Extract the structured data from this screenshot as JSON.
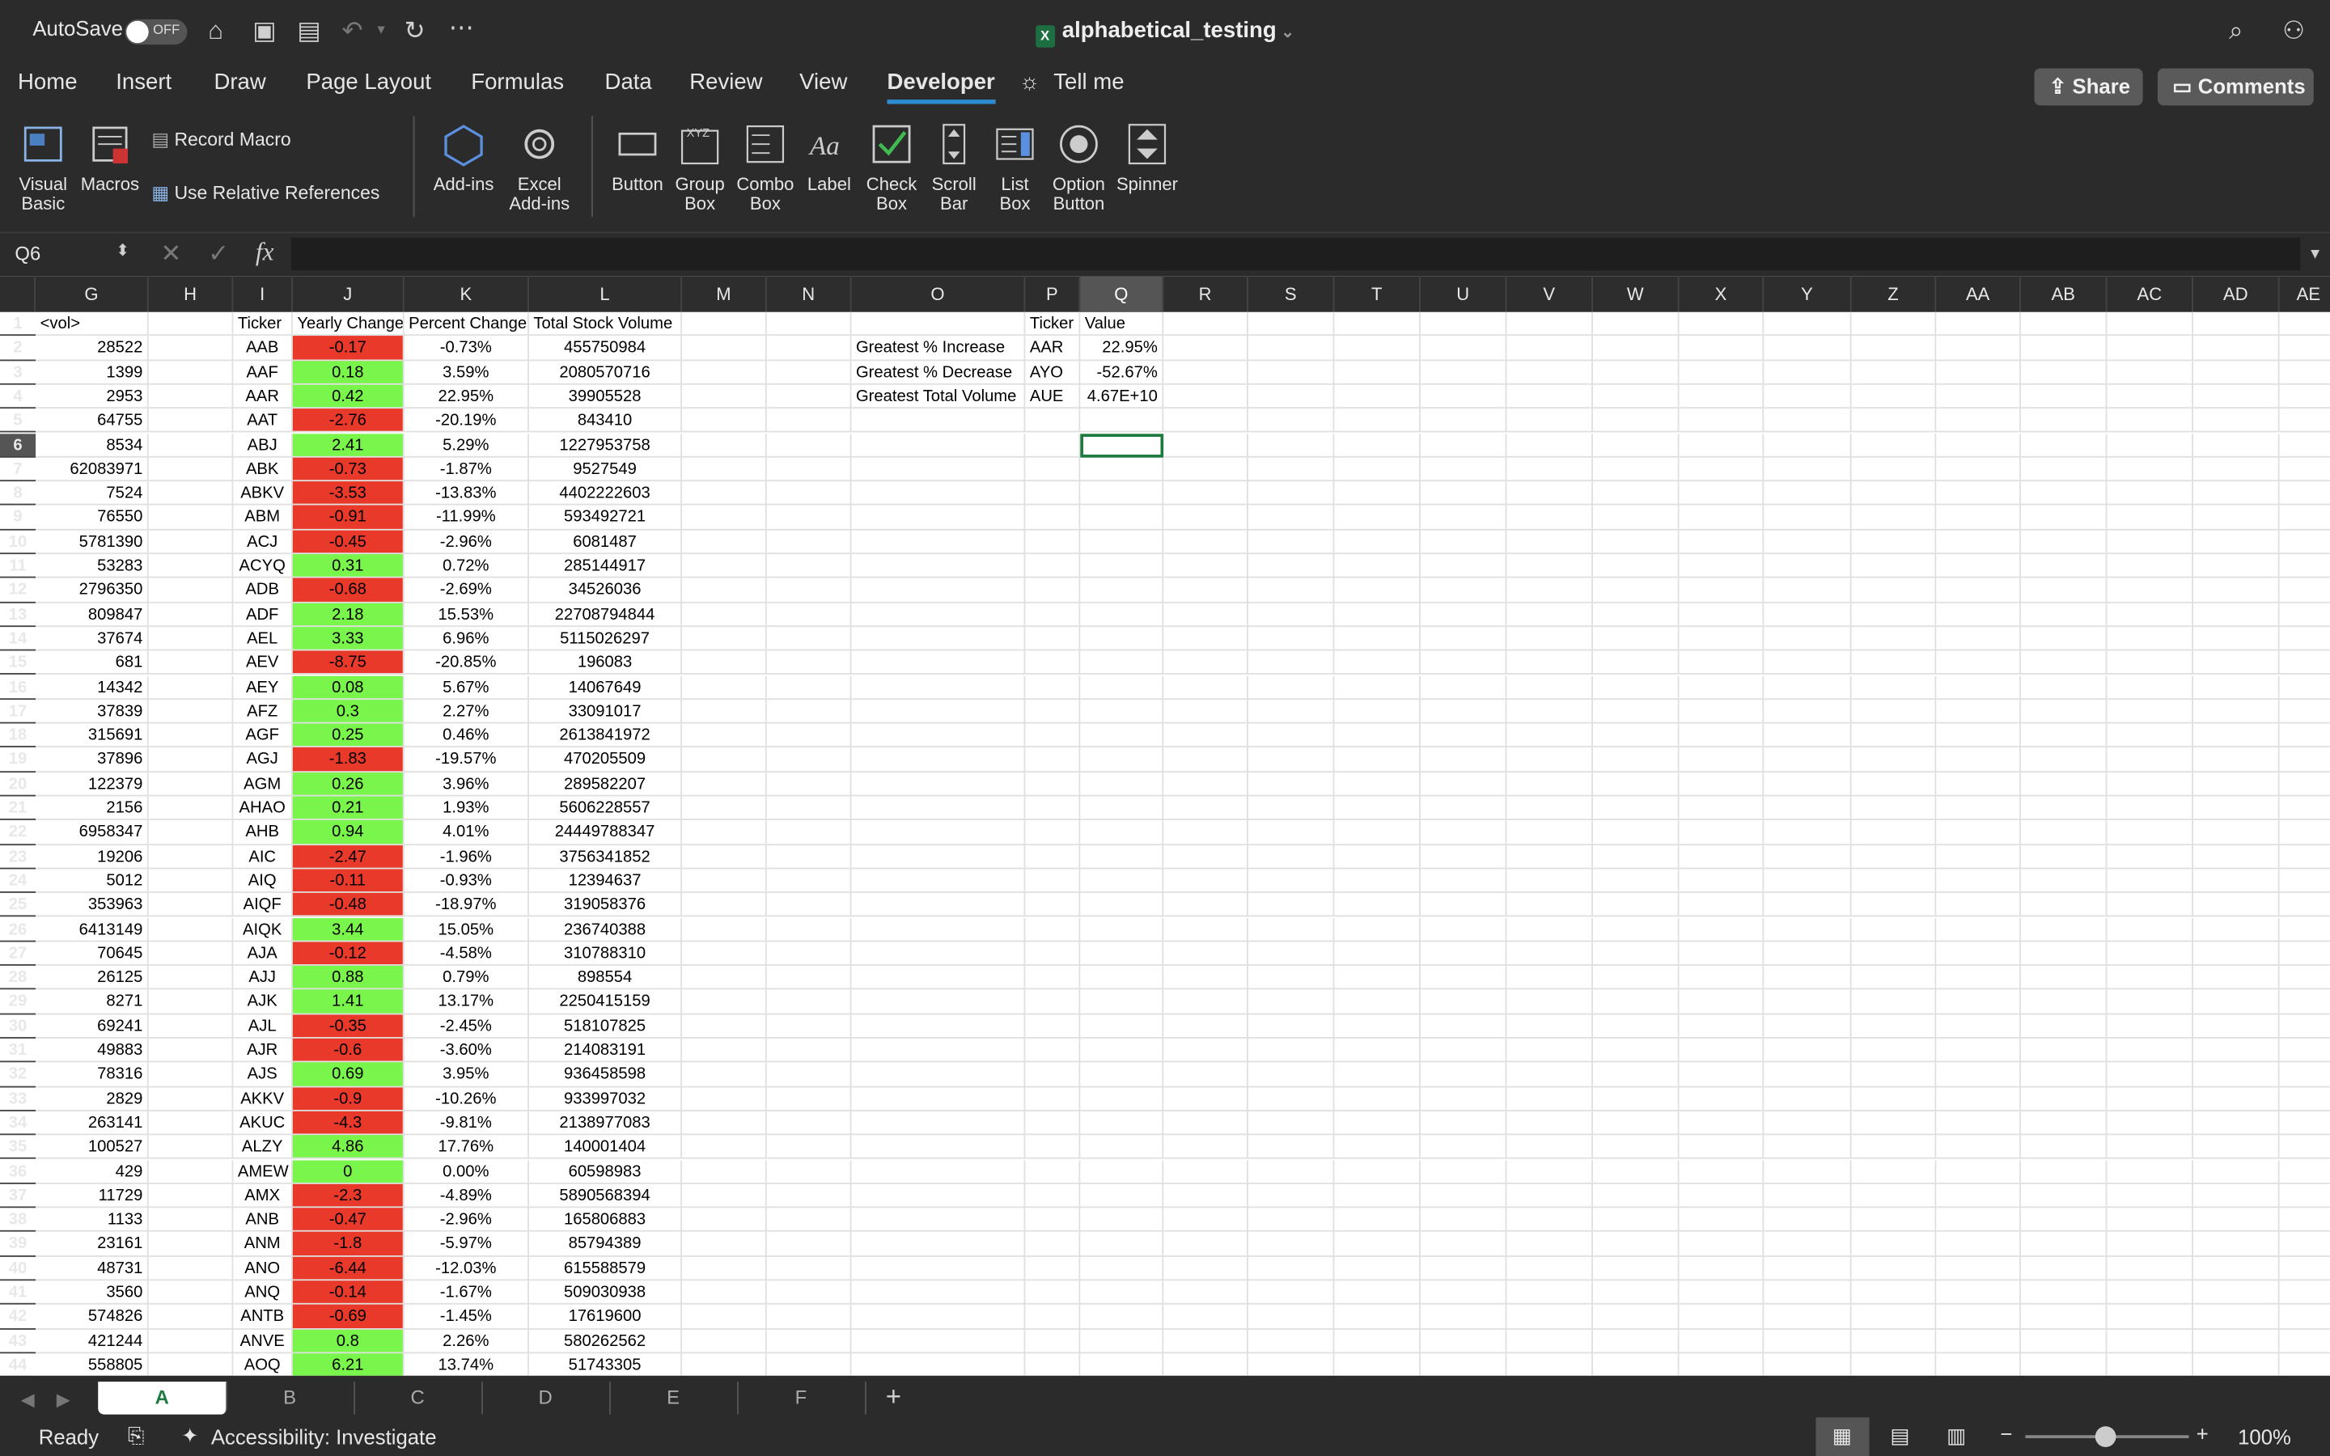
{
  "titlebar": {
    "autosave": "AutoSave",
    "toggle": "OFF",
    "title": "alphabetical_testing"
  },
  "tabs": [
    "Home",
    "Insert",
    "Draw",
    "Page Layout",
    "Formulas",
    "Data",
    "Review",
    "View",
    "Developer",
    "Tell me"
  ],
  "share": "Share",
  "comments": "Comments",
  "ribbon": {
    "visual_basic": "Visual Basic",
    "macros": "Macros",
    "record_macro": "Record Macro",
    "relative_refs": "Use Relative References",
    "addins": "Add-ins",
    "excel_addins": "Excel Add-ins",
    "button": "Button",
    "group_box": "Group Box",
    "combo_box": "Combo Box",
    "label": "Label",
    "check_box": "Check Box",
    "scroll_bar": "Scroll Bar",
    "list_box": "List Box",
    "option_button": "Option Button",
    "spinner": "Spinner"
  },
  "namebox": "Q6",
  "columns": [
    "G",
    "H",
    "I",
    "J",
    "K",
    "L",
    "M",
    "N",
    "O",
    "P",
    "Q",
    "R",
    "S",
    "T",
    "U",
    "V",
    "W",
    "X",
    "Y",
    "Z",
    "AA",
    "AB",
    "AC",
    "AD",
    "AE"
  ],
  "header_row": {
    "g": "<vol>",
    "i": "Ticker",
    "j": "Yearly Change",
    "k": "Percent Change",
    "l": "Total Stock Volume",
    "p": "Ticker",
    "q": "Value"
  },
  "summary": [
    {
      "label": "Greatest % Increase",
      "ticker": "AAR",
      "value": "22.95%"
    },
    {
      "label": "Greatest % Decrease",
      "ticker": "AYO",
      "value": "-52.67%"
    },
    {
      "label": "Greatest Total Volume",
      "ticker": "AUE",
      "value": "4.67E+10"
    }
  ],
  "rows": [
    {
      "n": "2",
      "g": "28522",
      "i": "AAB",
      "j": "-0.17",
      "k": "-0.73%",
      "l": "455750984"
    },
    {
      "n": "3",
      "g": "1399",
      "i": "AAF",
      "j": "0.18",
      "k": "3.59%",
      "l": "2080570716"
    },
    {
      "n": "4",
      "g": "2953",
      "i": "AAR",
      "j": "0.42",
      "k": "22.95%",
      "l": "39905528"
    },
    {
      "n": "5",
      "g": "64755",
      "i": "AAT",
      "j": "-2.76",
      "k": "-20.19%",
      "l": "843410"
    },
    {
      "n": "6",
      "g": "8534",
      "i": "ABJ",
      "j": "2.41",
      "k": "5.29%",
      "l": "1227953758"
    },
    {
      "n": "7",
      "g": "62083971",
      "i": "ABK",
      "j": "-0.73",
      "k": "-1.87%",
      "l": "9527549"
    },
    {
      "n": "8",
      "g": "7524",
      "i": "ABKV",
      "j": "-3.53",
      "k": "-13.83%",
      "l": "4402222603"
    },
    {
      "n": "9",
      "g": "76550",
      "i": "ABM",
      "j": "-0.91",
      "k": "-11.99%",
      "l": "593492721"
    },
    {
      "n": "10",
      "g": "5781390",
      "i": "ACJ",
      "j": "-0.45",
      "k": "-2.96%",
      "l": "6081487"
    },
    {
      "n": "11",
      "g": "53283",
      "i": "ACYQ",
      "j": "0.31",
      "k": "0.72%",
      "l": "285144917"
    },
    {
      "n": "12",
      "g": "2796350",
      "i": "ADB",
      "j": "-0.68",
      "k": "-2.69%",
      "l": "34526036"
    },
    {
      "n": "13",
      "g": "809847",
      "i": "ADF",
      "j": "2.18",
      "k": "15.53%",
      "l": "22708794844"
    },
    {
      "n": "14",
      "g": "37674",
      "i": "AEL",
      "j": "3.33",
      "k": "6.96%",
      "l": "5115026297"
    },
    {
      "n": "15",
      "g": "681",
      "i": "AEV",
      "j": "-8.75",
      "k": "-20.85%",
      "l": "196083"
    },
    {
      "n": "16",
      "g": "14342",
      "i": "AEY",
      "j": "0.08",
      "k": "5.67%",
      "l": "14067649"
    },
    {
      "n": "17",
      "g": "37839",
      "i": "AFZ",
      "j": "0.3",
      "k": "2.27%",
      "l": "33091017"
    },
    {
      "n": "18",
      "g": "315691",
      "i": "AGF",
      "j": "0.25",
      "k": "0.46%",
      "l": "2613841972"
    },
    {
      "n": "19",
      "g": "37896",
      "i": "AGJ",
      "j": "-1.83",
      "k": "-19.57%",
      "l": "470205509"
    },
    {
      "n": "20",
      "g": "122379",
      "i": "AGM",
      "j": "0.26",
      "k": "3.96%",
      "l": "289582207"
    },
    {
      "n": "21",
      "g": "2156",
      "i": "AHAO",
      "j": "0.21",
      "k": "1.93%",
      "l": "5606228557"
    },
    {
      "n": "22",
      "g": "6958347",
      "i": "AHB",
      "j": "0.94",
      "k": "4.01%",
      "l": "24449788347"
    },
    {
      "n": "23",
      "g": "19206",
      "i": "AIC",
      "j": "-2.47",
      "k": "-1.96%",
      "l": "3756341852"
    },
    {
      "n": "24",
      "g": "5012",
      "i": "AIQ",
      "j": "-0.11",
      "k": "-0.93%",
      "l": "12394637"
    },
    {
      "n": "25",
      "g": "353963",
      "i": "AIQF",
      "j": "-0.48",
      "k": "-18.97%",
      "l": "319058376"
    },
    {
      "n": "26",
      "g": "6413149",
      "i": "AIQK",
      "j": "3.44",
      "k": "15.05%",
      "l": "236740388"
    },
    {
      "n": "27",
      "g": "70645",
      "i": "AJA",
      "j": "-0.12",
      "k": "-4.58%",
      "l": "310788310"
    },
    {
      "n": "28",
      "g": "26125",
      "i": "AJJ",
      "j": "0.88",
      "k": "0.79%",
      "l": "898554"
    },
    {
      "n": "29",
      "g": "8271",
      "i": "AJK",
      "j": "1.41",
      "k": "13.17%",
      "l": "2250415159"
    },
    {
      "n": "30",
      "g": "69241",
      "i": "AJL",
      "j": "-0.35",
      "k": "-2.45%",
      "l": "518107825"
    },
    {
      "n": "31",
      "g": "49883",
      "i": "AJR",
      "j": "-0.6",
      "k": "-3.60%",
      "l": "214083191"
    },
    {
      "n": "32",
      "g": "78316",
      "i": "AJS",
      "j": "0.69",
      "k": "3.95%",
      "l": "936458598"
    },
    {
      "n": "33",
      "g": "2829",
      "i": "AKKV",
      "j": "-0.9",
      "k": "-10.26%",
      "l": "933997032"
    },
    {
      "n": "34",
      "g": "263141",
      "i": "AKUC",
      "j": "-4.3",
      "k": "-9.81%",
      "l": "2138977083"
    },
    {
      "n": "35",
      "g": "100527",
      "i": "ALZY",
      "j": "4.86",
      "k": "17.76%",
      "l": "140001404"
    },
    {
      "n": "36",
      "g": "429",
      "i": "AMEW",
      "j": "0",
      "k": "0.00%",
      "l": "60598983"
    },
    {
      "n": "37",
      "g": "11729",
      "i": "AMX",
      "j": "-2.3",
      "k": "-4.89%",
      "l": "5890568394"
    },
    {
      "n": "38",
      "g": "1133",
      "i": "ANB",
      "j": "-0.47",
      "k": "-2.96%",
      "l": "165806883"
    },
    {
      "n": "39",
      "g": "23161",
      "i": "ANM",
      "j": "-1.8",
      "k": "-5.97%",
      "l": "85794389"
    },
    {
      "n": "40",
      "g": "48731",
      "i": "ANO",
      "j": "-6.44",
      "k": "-12.03%",
      "l": "615588579"
    },
    {
      "n": "41",
      "g": "3560",
      "i": "ANQ",
      "j": "-0.14",
      "k": "-1.67%",
      "l": "509030938"
    },
    {
      "n": "42",
      "g": "574826",
      "i": "ANTB",
      "j": "-0.69",
      "k": "-1.45%",
      "l": "17619600"
    },
    {
      "n": "43",
      "g": "421244",
      "i": "ANVE",
      "j": "0.8",
      "k": "2.26%",
      "l": "580262562"
    },
    {
      "n": "44",
      "g": "558805",
      "i": "AOQ",
      "j": "6.21",
      "k": "13.74%",
      "l": "51743305"
    }
  ],
  "sheets": [
    "A",
    "B",
    "C",
    "D",
    "E",
    "F"
  ],
  "status": {
    "ready": "Ready",
    "accessibility": "Accessibility: Investigate",
    "zoom": "100%"
  },
  "colors": {
    "positive": "#79f54b",
    "negative": "#e8392a",
    "accent": "#2f8bd0"
  }
}
